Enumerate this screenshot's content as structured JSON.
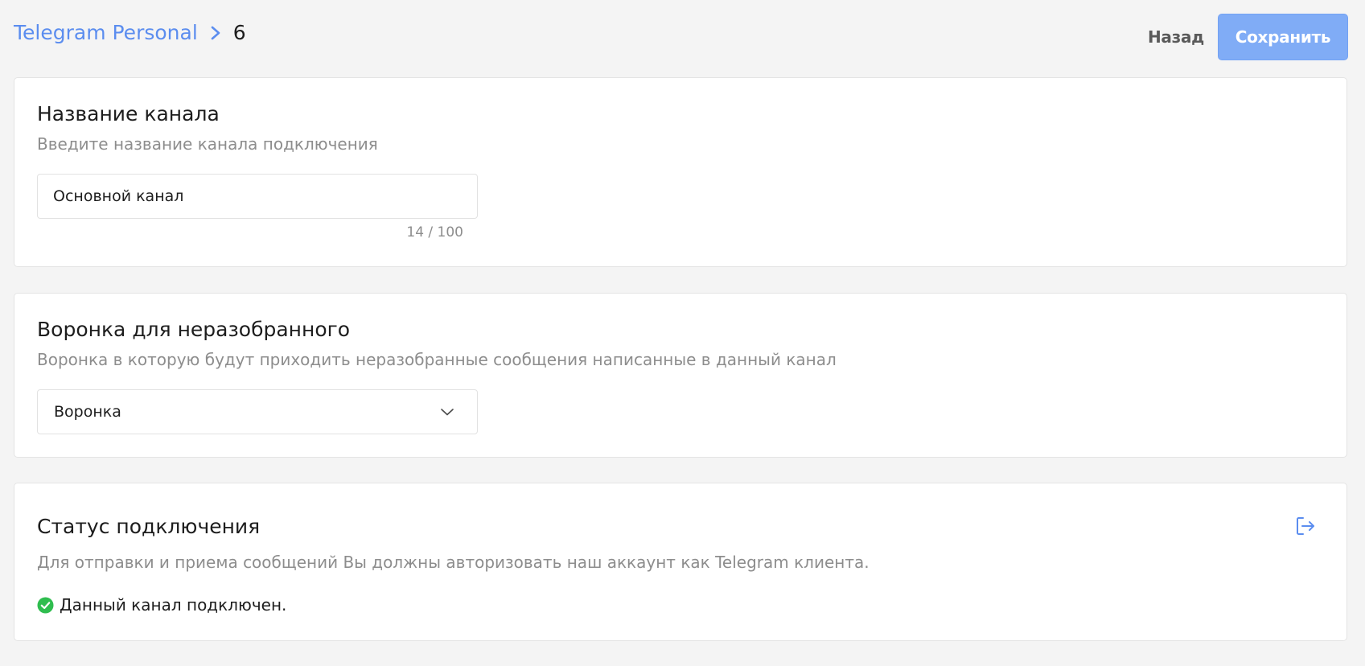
{
  "header": {
    "breadcrumb": {
      "parent": "Telegram Personal",
      "current": "6"
    },
    "back_label": "Назад",
    "save_label": "Сохранить"
  },
  "channel_name": {
    "title": "Название канала",
    "subtitle": "Введите название канала подключения",
    "value": "Основной канал",
    "counter": "14 / 100"
  },
  "funnel": {
    "title": "Воронка для неразобранного",
    "subtitle": "Воронка в которую будут приходить неразобранные сообщения написанные в данный канал",
    "selected": "Воронка"
  },
  "connection": {
    "title": "Статус подключения",
    "subtitle": "Для отправки и приема сообщений Вы должны авторизовать наш аккаунт как Telegram клиента.",
    "status_text": "Данный канал подключен."
  },
  "icons": {
    "breadcrumb_separator": "chevron-right-icon",
    "select_arrow": "chevron-down-icon",
    "logout": "logout-icon",
    "status": "check-circle-icon"
  },
  "colors": {
    "accent": "#5b8def",
    "save_button": "#80acf6",
    "success": "#2fbd4f",
    "muted_text": "#8d8d8d",
    "background": "#f4f4f4"
  }
}
